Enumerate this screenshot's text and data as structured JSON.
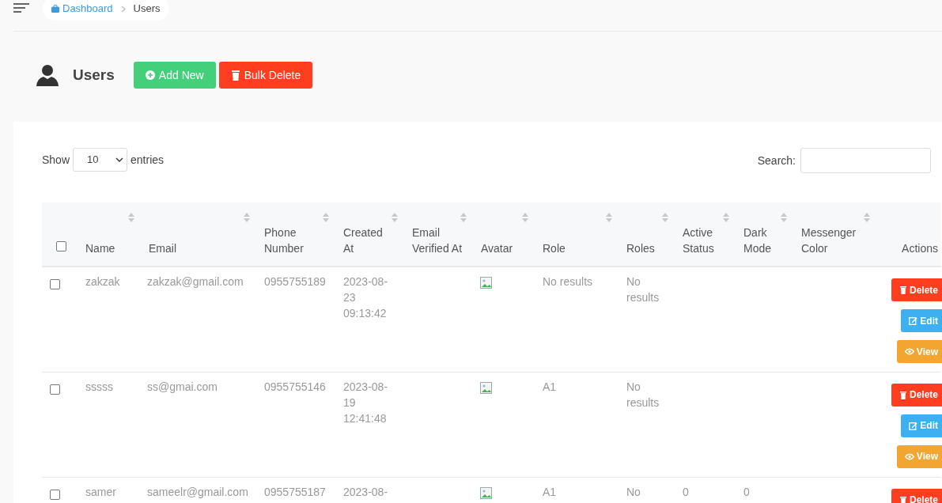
{
  "breadcrumb": [
    {
      "label": "Dashboard",
      "kind": "link"
    },
    {
      "label": "Users",
      "kind": "current"
    }
  ],
  "page": {
    "title": "Users",
    "buttons": [
      {
        "label": "Add New",
        "kind": "add"
      },
      {
        "label": "Bulk Delete",
        "kind": "delete"
      }
    ]
  },
  "length": {
    "label_before": "Show",
    "value": "10",
    "label_after": "entries"
  },
  "search": {
    "label": "Search:"
  },
  "table": {
    "select_all": {
      "checked": false
    },
    "columns": [
      {
        "label": "Name",
        "sortable": true
      },
      {
        "label": "Email",
        "sortable": true
      },
      {
        "label": "Phone Number",
        "sortable": true
      },
      {
        "label": "Created At",
        "sortable": true
      },
      {
        "label": "Email Verified At",
        "sortable": true
      },
      {
        "label": "Avatar",
        "sortable": true
      },
      {
        "label": "Role",
        "sortable": true
      },
      {
        "label": "Roles",
        "sortable": true
      },
      {
        "label": "Active Status",
        "sortable": true
      },
      {
        "label": "Dark Mode",
        "sortable": true
      },
      {
        "label": "Messenger Color",
        "sortable": true
      },
      {
        "label": "Actions",
        "sortable": false
      }
    ],
    "rows": [
      {
        "checked": false,
        "name": "zakzak",
        "email": "zakzak@gmail.com",
        "phone": "0955755189",
        "created": "2023-08-23 09:13:42",
        "role": "No results",
        "roles": "No results",
        "active": "",
        "dark": "",
        "actions": [
          {
            "label": "Delete",
            "kind": "delete"
          },
          {
            "label": "Edit",
            "kind": "edit"
          },
          {
            "label": "View",
            "kind": "view"
          }
        ]
      },
      {
        "checked": false,
        "name": "sssss",
        "email": "ss@gmai.com",
        "phone": "0955755146",
        "created": "2023-08-19 12:41:48",
        "role": "A1",
        "roles": "No results",
        "active": "",
        "dark": "",
        "actions": [
          {
            "label": "Delete",
            "kind": "delete"
          },
          {
            "label": "Edit",
            "kind": "edit"
          },
          {
            "label": "View",
            "kind": "view"
          }
        ]
      },
      {
        "checked": false,
        "name": "samer",
        "email": "sameelr@gmail.com",
        "phone": "0955755187",
        "created": "2023-08-",
        "role": "A1",
        "roles": "No",
        "active": "0",
        "dark": "0",
        "actions": [
          {
            "label": "Delete",
            "kind": "delete"
          }
        ]
      }
    ]
  }
}
